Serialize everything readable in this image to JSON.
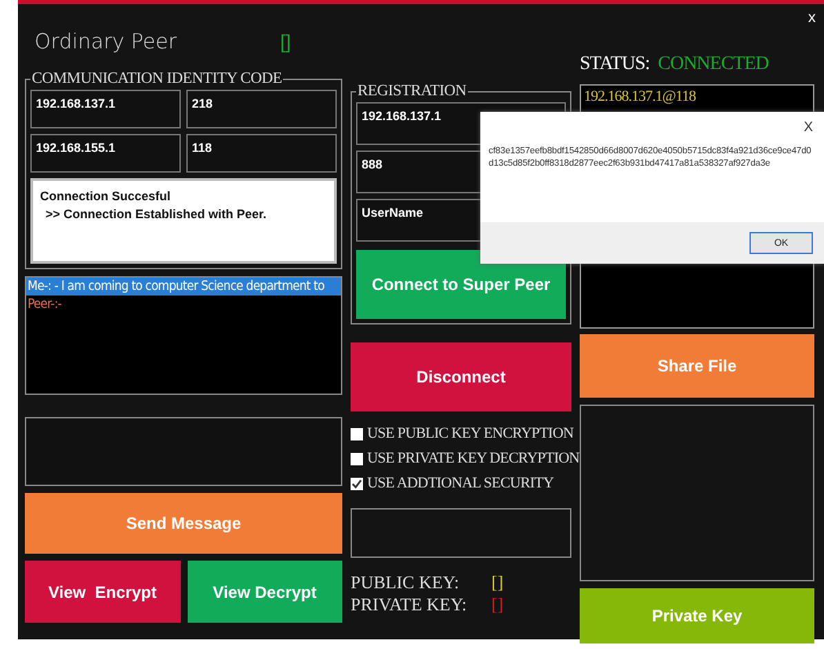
{
  "window": {
    "title": "Ordinary Peer",
    "indicator": {
      "text": "[]",
      "color": "#1fa82e"
    },
    "close": "x"
  },
  "identity": {
    "legend": "COMMUNICATION IDENTITY CODE",
    "fields": [
      {
        "value": "192.168.137.1"
      },
      {
        "value": "218"
      },
      {
        "value": "192.168.155.1"
      },
      {
        "value": "118"
      }
    ],
    "log": [
      "Connection Succesful",
      ">> Connection Established with Peer."
    ]
  },
  "chat": [
    {
      "text": "Me-: - I am coming to computer Science department to",
      "selected": true,
      "kind": "me"
    },
    {
      "text": "Peer-:-",
      "selected": false,
      "kind": "peer"
    }
  ],
  "registration": {
    "legend": "REGISTRATION",
    "fields": [
      {
        "value": "192.168.137.1"
      },
      {
        "value": "888"
      },
      {
        "value": "UserName"
      }
    ],
    "connect_button": "Connect to Super Peer"
  },
  "disconnect_button": "Disconnect",
  "options": [
    {
      "label": "USE PUBLIC KEY ENCRYPTION",
      "checked": false
    },
    {
      "label": "USE PRIVATE KEY DECRYPTION",
      "checked": false
    },
    {
      "label": "USE ADDTIONAL SECURITY",
      "checked": true
    }
  ],
  "keys": [
    {
      "label": "PUBLIC KEY:",
      "indicator": "[]",
      "color": "#d8c82a"
    },
    {
      "label": "PRIVATE KEY:",
      "indicator": "[]",
      "color": "#d0201f"
    }
  ],
  "status": {
    "label": "STATUS:",
    "value": "CONNECTED"
  },
  "peers": [
    "192.168.137.1@118"
  ],
  "buttons": {
    "send": "Send Message",
    "view_encrypt": "View  Encrypt",
    "view_decrypt": "View Decrypt",
    "share": "Share File",
    "private_key": "Private Key"
  },
  "dialog": {
    "close": "X",
    "message": "cf83e1357eefb8bdf1542850d66d8007d620e4050b5715dc83f4a921d36ce9ce47d0d13c5d85f2b0ff8318d2877eec2f63b931bd47417a81a538327af927da3e",
    "ok": "OK"
  }
}
